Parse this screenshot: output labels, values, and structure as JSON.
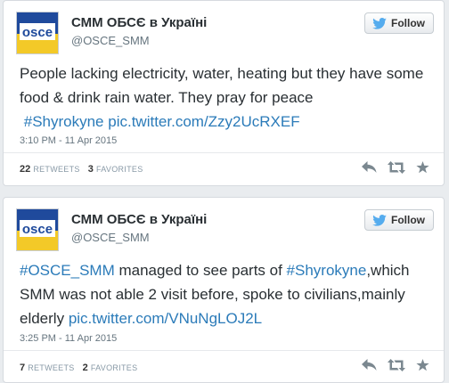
{
  "tweets": [
    {
      "author": {
        "name": "СММ ОБСЄ в Україні",
        "handle": "@OSCE_SMM",
        "avatar_text": "osce"
      },
      "follow_label": "Follow",
      "text": {
        "plain": "People lacking electricity, water, heating but they have some food & drink rain water. They pray for peace",
        "hashtag": "#Shyrokyne",
        "link": "pic.twitter.com/Zzy2UcRXEF"
      },
      "timestamp": "3:10 PM - 11 Apr 2015",
      "retweets": {
        "count": "22",
        "label": "RETWEETS"
      },
      "favorites": {
        "count": "3",
        "label": "FAVORITES"
      }
    },
    {
      "author": {
        "name": "СММ ОБСЄ в Україні",
        "handle": "@OSCE_SMM",
        "avatar_text": "osce"
      },
      "follow_label": "Follow",
      "text": {
        "hashtag1": "#OSCE_SMM",
        "mid": " managed to see parts of ",
        "hashtag2": "#Shyrokyne",
        "rest": ",which SMM was not able 2 visit before, spoke to civilians,mainly elderly ",
        "link": "pic.twitter.com/VNuNgLOJ2L"
      },
      "timestamp": "3:25 PM - 11 Apr 2015",
      "retweets": {
        "count": "7",
        "label": "RETWEETS"
      },
      "favorites": {
        "count": "2",
        "label": "FAVORITES"
      }
    }
  ],
  "colors": {
    "link": "#2b7bb9",
    "avatar_blue": "#1f4a9c",
    "avatar_yellow": "#f3c928",
    "twitter_bird": "#55acee"
  },
  "icons": [
    "reply-icon",
    "retweet-icon",
    "favorite-icon",
    "twitter-bird-icon"
  ]
}
